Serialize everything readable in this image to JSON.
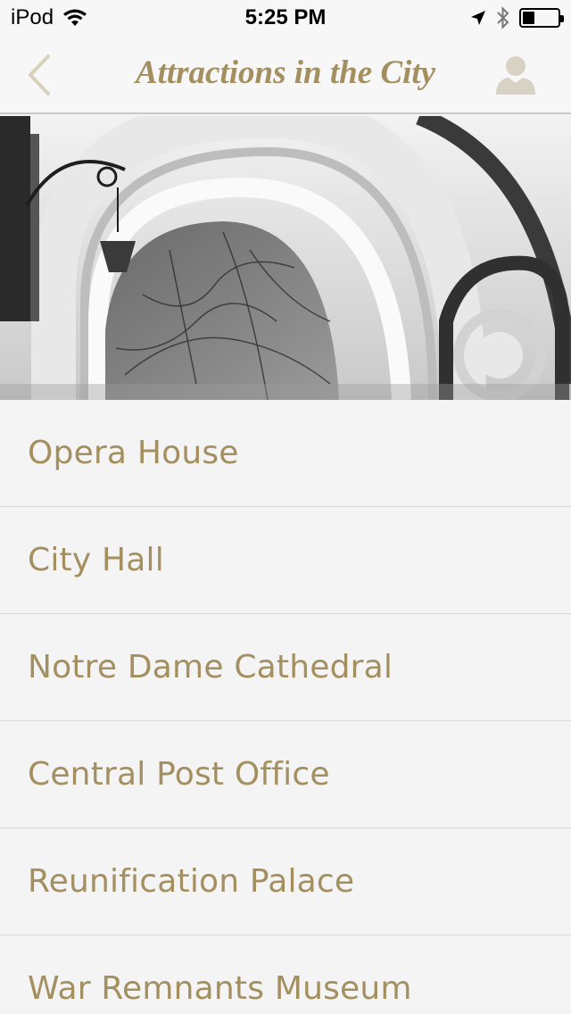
{
  "status_bar": {
    "device": "iPod",
    "time": "5:25 PM",
    "battery_level": 0.35
  },
  "nav": {
    "title": "Attractions in the City",
    "back_icon": "chevron-left-icon",
    "profile_icon": "user-icon"
  },
  "colors": {
    "accent": "#a38f60",
    "background": "#f4f4f4",
    "divider": "#d8d8d8"
  },
  "attractions": [
    {
      "label": "Opera House"
    },
    {
      "label": "City Hall"
    },
    {
      "label": "Notre Dame Cathedral"
    },
    {
      "label": "Central Post Office"
    },
    {
      "label": "Reunification Palace"
    },
    {
      "label": "War Remnants Museum"
    }
  ]
}
